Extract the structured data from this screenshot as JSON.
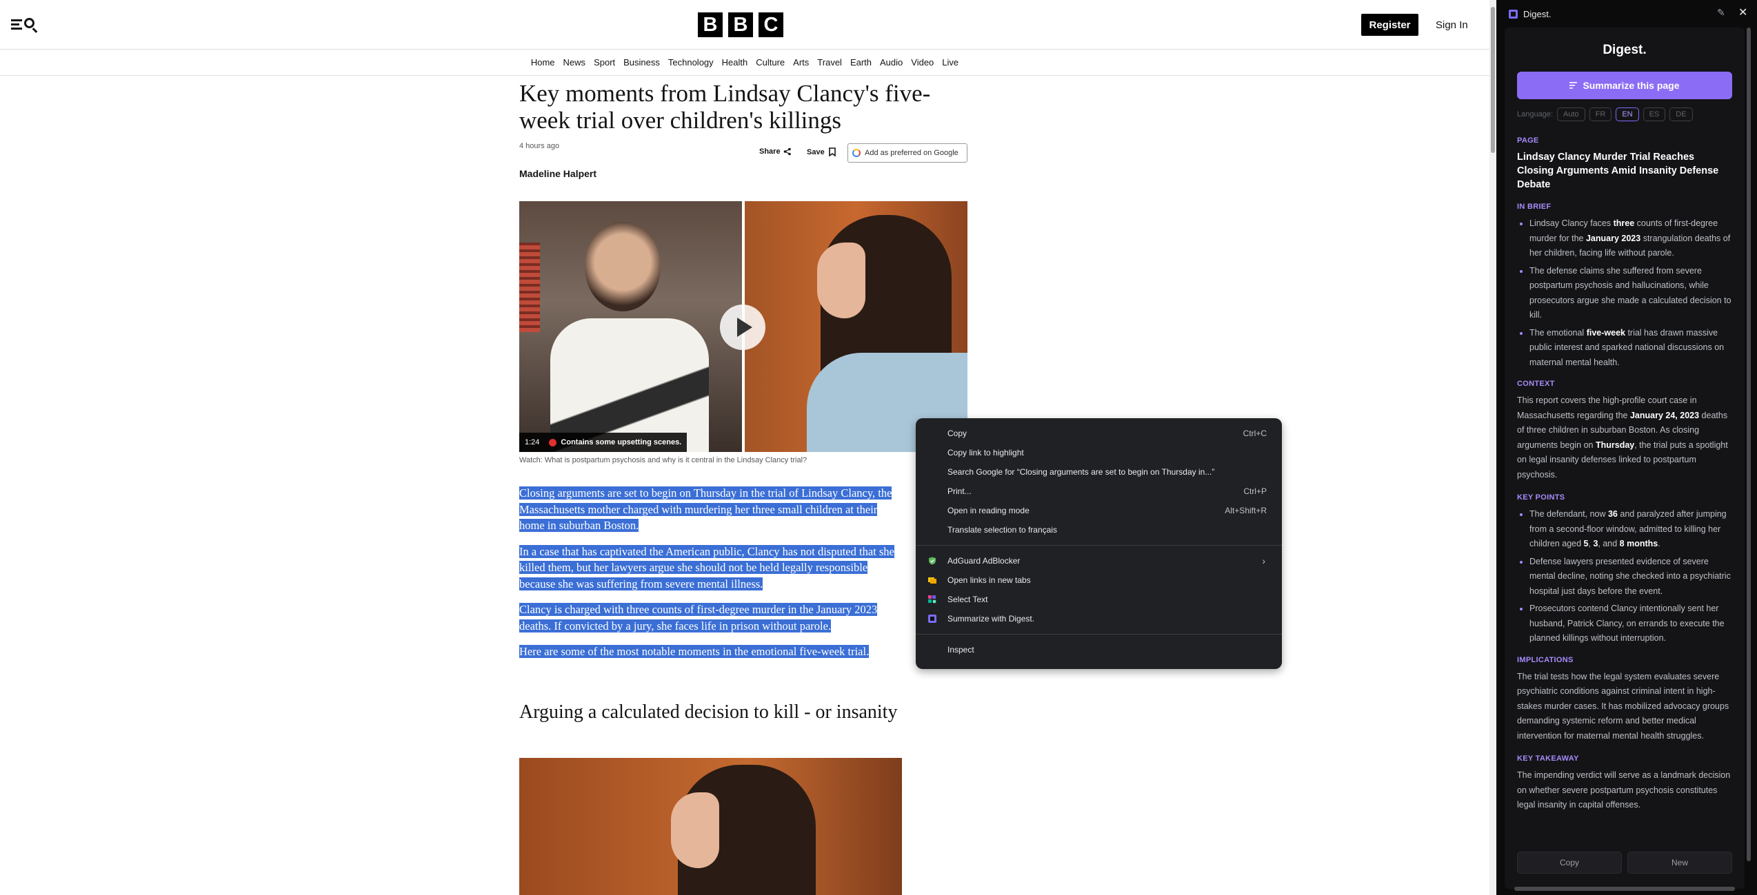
{
  "header": {
    "logo_letters": [
      "B",
      "B",
      "C"
    ],
    "register_label": "Register",
    "signin_label": "Sign In"
  },
  "nav": [
    "Home",
    "News",
    "Sport",
    "Business",
    "Technology",
    "Health",
    "Culture",
    "Arts",
    "Travel",
    "Earth",
    "Audio",
    "Video",
    "Live"
  ],
  "article": {
    "headline": "Key moments from Lindsay Clancy's five-week trial over children's killings",
    "timestamp": "4 hours ago",
    "share_label": "Share",
    "save_label": "Save",
    "preferred_label": "Add as preferred on Google",
    "author": "Madeline Halpert",
    "video_duration": "1:24",
    "video_warning": "Contains some upsetting scenes.",
    "caption": "Watch: What is postpartum psychosis and why is it central in the Lindsay Clancy trial?",
    "paragraphs": [
      "Closing arguments are set to begin on Thursday in the trial of Lindsay Clancy, the Massachusetts mother charged with murdering her three small children at their home in suburban Boston.",
      "In a case that has captivated the American public, Clancy has not disputed that she killed them, but her lawyers argue she should not be held legally responsible because she was suffering from severe mental illness.",
      "Clancy is charged with three counts of first-degree murder in the January 2023 deaths. If convicted by a jury, she faces life in prison without parole.",
      "Here are some of the most notable moments in the emotional five-week trial."
    ],
    "subheading": "Arguing a calculated decision to kill - or insanity"
  },
  "context_menu": {
    "items": [
      {
        "label": "Copy",
        "shortcut": "Ctrl+C"
      },
      {
        "label": "Copy link to highlight",
        "shortcut": ""
      },
      {
        "label": "Search Google for “Closing arguments are set to begin on Thursday in...”",
        "shortcut": ""
      },
      {
        "label": "Print...",
        "shortcut": "Ctrl+P"
      },
      {
        "label": "Open in reading mode",
        "shortcut": "Alt+Shift+R"
      },
      {
        "label": "Translate selection to français",
        "shortcut": ""
      }
    ],
    "extensions": [
      {
        "label": "AdGuard AdBlocker",
        "icon": "shield-icon"
      },
      {
        "label": "Open links in new tabs",
        "icon": "tabs-icon"
      },
      {
        "label": "Select Text",
        "icon": "select-text-icon"
      },
      {
        "label": "Summarize with Digest.",
        "icon": "digest-icon"
      }
    ],
    "inspect_label": "Inspect"
  },
  "side_panel": {
    "window_title": "Digest.",
    "brand": "Digest.",
    "summarize_label": "Summarize this page",
    "language_label": "Language:",
    "languages": [
      "Auto",
      "FR",
      "EN",
      "ES",
      "DE"
    ],
    "selected_language": "EN",
    "sections": {
      "page": "PAGE",
      "page_title": "Lindsay Clancy Murder Trial Reaches Closing Arguments Amid Insanity Defense Debate",
      "in_brief": "IN BRIEF",
      "context": "CONTEXT",
      "key_points": "KEY POINTS",
      "implications": "IMPLICATIONS",
      "key_takeaway": "KEY TAKEAWAY"
    },
    "brief_items": [
      "Lindsay Clancy faces <b>three</b> counts of first-degree murder for the <b>January 2023</b> strangulation deaths of her children, facing life without parole.",
      "The defense claims she suffered from severe postpartum psychosis and hallucinations, while prosecutors argue she made a calculated decision to kill.",
      "The emotional <b>five-week</b> trial has drawn massive public interest and sparked national discussions on maternal mental health."
    ],
    "context_text": "This report covers the high-profile court case in Massachusetts regarding the <b>January 24, 2023</b> deaths of three children in suburban Boston. As closing arguments begin on <b>Thursday</b>, the trial puts a spotlight on legal insanity defenses linked to postpartum psychosis.",
    "key_points": [
      "The defendant, now <b>36</b> and paralyzed after jumping from a second-floor window, admitted to killing her children aged <b>5</b>, <b>3</b>, and <b>8 months</b>.",
      "Defense lawyers presented evidence of severe mental decline, noting she checked into a psychiatric hospital just days before the event.",
      "Prosecutors contend Clancy intentionally sent her husband, Patrick Clancy, on errands to execute the planned killings without interruption."
    ],
    "implications_text": "The trial tests how the legal system evaluates severe psychiatric conditions against criminal intent in high-stakes murder cases. It has mobilized advocacy groups demanding systemic reform and better medical intervention for maternal mental health struggles.",
    "takeaway_text": "The impending verdict will serve as a landmark decision on whether severe postpartum psychosis constitutes legal insanity in capital offenses.",
    "copy_label": "Copy",
    "new_label": "New"
  }
}
